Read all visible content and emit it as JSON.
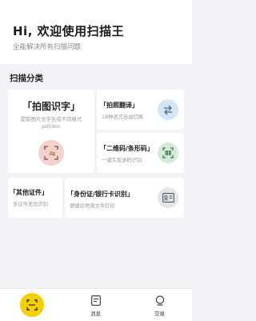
{
  "header": {
    "title": "Hi, 欢迎使用扫描王",
    "subtitle": "全能解决所有扫描问题"
  },
  "section": {
    "title": "扫描分类"
  },
  "cards": {
    "photo_text": {
      "title": "「拍图识字」",
      "desc": "提取图片文字生成不同格式pdf/doc",
      "icon": "text-scan-icon",
      "accent": "#f6dcd6"
    },
    "translate": {
      "title": "「拍照翻译」",
      "desc": "18种语言自由切换",
      "icon": "translate-swap-icon",
      "accent": "#dbe9f6"
    },
    "qrcode": {
      "title": "「二维码/条形码」",
      "desc": "一键实现多码识别",
      "icon": "barcode-scan-icon",
      "accent": "#d9efe0"
    },
    "other_id": {
      "title": "「其他证件」",
      "desc": "多证件无忧识别"
    },
    "id_card": {
      "title": "「身份证/银行卡识别」",
      "desc": "便捷异地源文件打印",
      "icon": "id-card-icon",
      "accent": "#e6e8ec"
    }
  },
  "tabbar": {
    "scan_accent": "#f5d000",
    "messages_label": "消息",
    "trade_label": "交易"
  }
}
